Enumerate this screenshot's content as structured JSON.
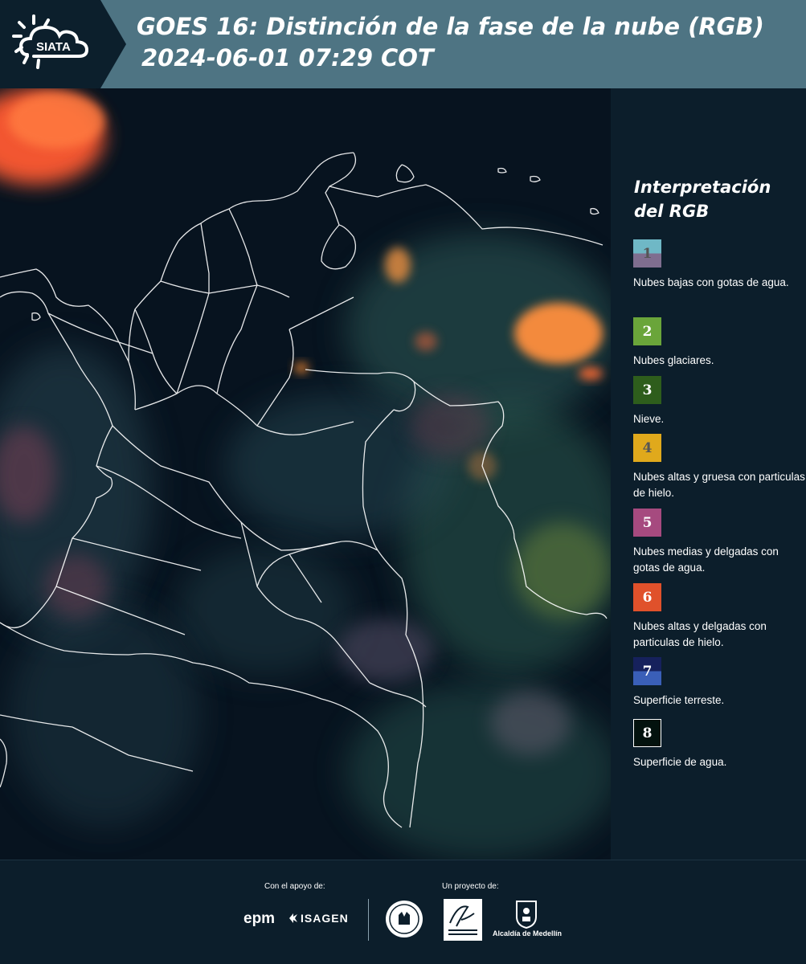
{
  "header": {
    "logo_text": "SIATA",
    "title_line1": "GOES 16: Distinción de la fase de la nube (RGB)",
    "title_line2": "2024-06-01 07:29 COT"
  },
  "legend": {
    "title": "Interpretación del RGB",
    "items": [
      {
        "number": "1",
        "label": "Nubes bajas con gotas de agua.",
        "color_top": "#6fb8c6",
        "color_bottom": "#7f6e8f",
        "number_color": "#555555"
      },
      {
        "number": "2",
        "label": "Nubes glaciares.",
        "color": "#6aa53a",
        "number_color": "#ffffff"
      },
      {
        "number": "3",
        "label": "Nieve.",
        "color": "#2e5d1c",
        "number_color": "#ffffff"
      },
      {
        "number": "4",
        "label": "Nubes altas y gruesa con particulas de hielo.",
        "color": "#e0a91c",
        "number_color": "#555555"
      },
      {
        "number": "5",
        "label": "Nubes medias y delgadas con gotas de agua.",
        "color": "#a64a7f",
        "number_color": "#ffffff"
      },
      {
        "number": "6",
        "label": "Nubes altas y delgadas con particulas de hielo.",
        "color": "#e0512b",
        "number_color": "#ffffff"
      },
      {
        "number": "7",
        "label": "Superficie terreste.",
        "color_top": "#16215c",
        "color_bottom": "#3a5fb8",
        "number_color": "#ffffff"
      },
      {
        "number": "8",
        "label": "Superficie de agua.",
        "color": "#03120e",
        "border": "#ffffff",
        "number_color": "#ffffff"
      }
    ]
  },
  "footer": {
    "support_label": "Con el apoyo de:",
    "project_label": "Un proyecto de:",
    "sponsor_1": "epm",
    "sponsor_2": "ISAGEN",
    "partner_3": "Alcaldía de Medellín"
  }
}
